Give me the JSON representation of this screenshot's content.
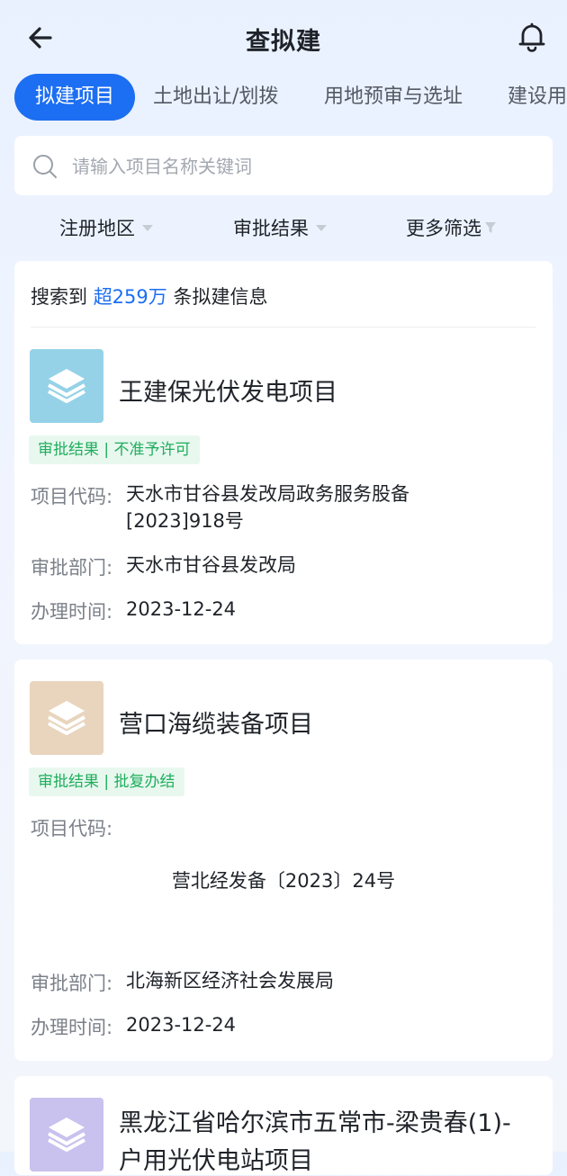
{
  "header": {
    "title": "查拟建",
    "back_icon": "arrow-left-icon",
    "notify_icon": "bell-icon"
  },
  "tabs": [
    {
      "label": "拟建项目",
      "active": true
    },
    {
      "label": "土地出让/划拨",
      "active": false
    },
    {
      "label": "用地预审与选址",
      "active": false
    },
    {
      "label": "建设用",
      "active": false
    }
  ],
  "search": {
    "placeholder": "请输入项目名称关键词",
    "value": ""
  },
  "filters": [
    {
      "label": "注册地区"
    },
    {
      "label": "审批结果"
    },
    {
      "label": "更多筛选"
    }
  ],
  "results": {
    "prefix": "搜索到",
    "count": "超259万",
    "suffix": "条拟建信息"
  },
  "field_labels": {
    "code": "项目代码:",
    "dept": "审批部门:",
    "time": "办理时间:"
  },
  "projects": [
    {
      "name": "王建保光伏发电项目",
      "icon_color": "#95d2e8",
      "badge": "审批结果 | 不准予许可",
      "code_line1": "天水市甘谷县发改局政务服务股备",
      "code_line2": "[2023]918号",
      "dept": "天水市甘谷县发改局",
      "time": "2023-12-24"
    },
    {
      "name": "营口海缆装备项目",
      "icon_color": "#e9d5be",
      "badge": "审批结果 | 批复办结",
      "code": "营北经发备〔2023〕24号",
      "dept": "北海新区经济社会发展局",
      "time": "2023-12-24"
    },
    {
      "name_line1": "黑龙江省哈尔滨市五常市-梁贵春(1)-",
      "name_line2": "户用光伏电站项目",
      "icon_color": "#c9c1ee"
    }
  ]
}
